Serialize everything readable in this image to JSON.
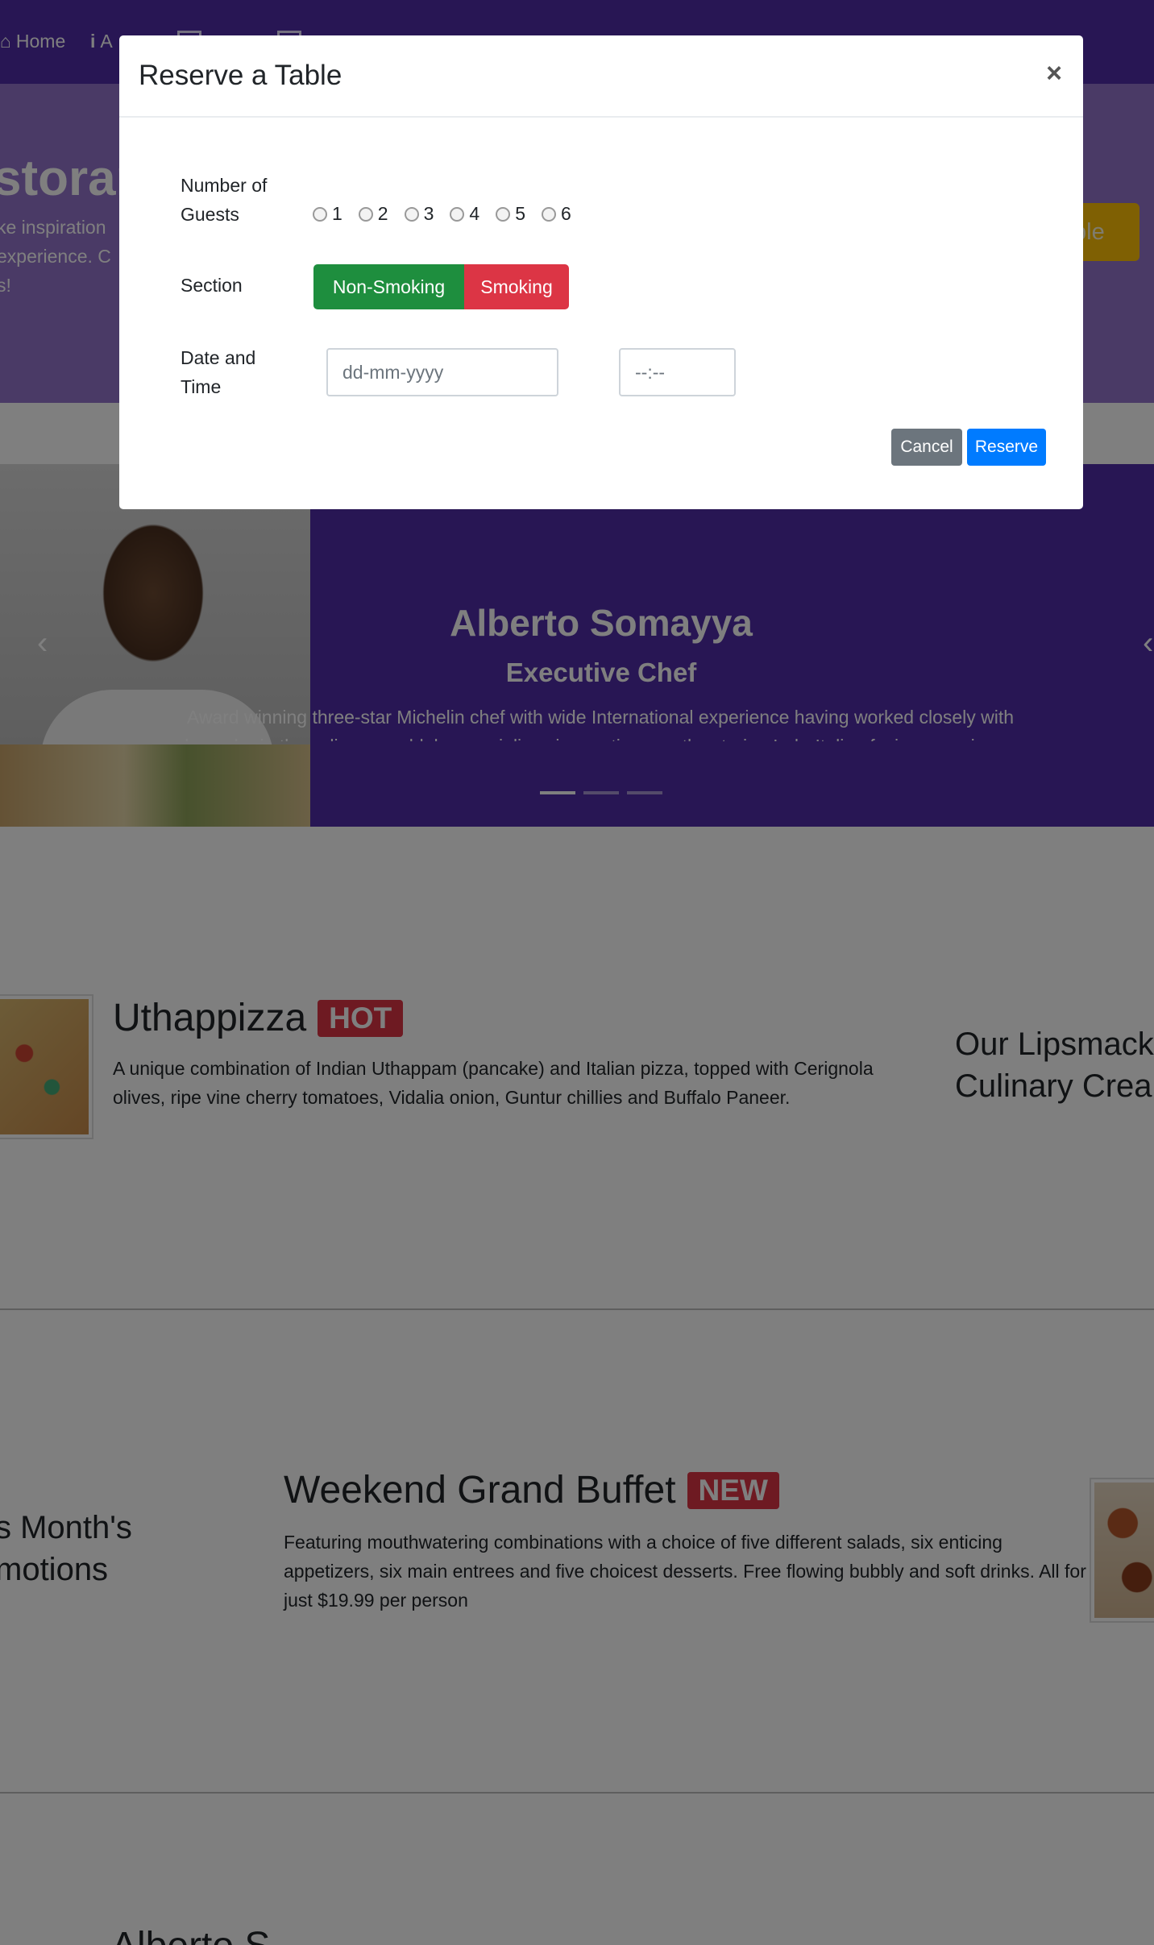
{
  "navbar": {
    "home_label": "Home",
    "about_label": "A",
    "home_icon": "home-icon",
    "about_icon": "info-icon"
  },
  "jumbotron": {
    "title": "storan",
    "text_lines": [
      "ke inspiration",
      " experience. C",
      "s!"
    ],
    "reserve_button": "ble"
  },
  "carousel": {
    "name": "Alberto Somayya",
    "role": "Executive Chef",
    "description": "Award winning three-star Michelin chef with wide International experience having worked closely with whos-who in the culinary world, he specializes in creating mouthwatering Indo-Italian fusion experiences. ripe vine cherry tomatoes, Vidalia onion, Guntur chillies and Buffalo Paneer."
  },
  "dishes": [
    {
      "name": "Uthappizza",
      "badge": "HOT",
      "description": "A unique combination of Indian Uthappam (pancake) and Italian pizza, topped with Cerignola olives, ripe vine cherry tomatoes, Vidalia onion, Guntur chillies and Buffalo Paneer."
    }
  ],
  "side_headings": {
    "dishes": [
      "Our Lipsmack",
      "Culinary Crea"
    ],
    "promotions": [
      "s Month's",
      "motions"
    ]
  },
  "promotion": {
    "name": "Weekend Grand Buffet",
    "badge": "NEW",
    "description": "Featuring mouthwatering combinations with a choice of five different salads, six enticing appetizers, six main entrees and five choicest desserts. Free flowing bubbly and soft drinks. All for just $19.99 per person"
  },
  "leader_partial": "Alberto S",
  "modal": {
    "title": "Reserve a Table",
    "close": "×",
    "guests_label": "Number of Guests",
    "guest_options": [
      "1",
      "2",
      "3",
      "4",
      "5",
      "6"
    ],
    "section_label": "Section",
    "section_options": [
      "Non-Smoking",
      "Smoking"
    ],
    "datetime_label": "Date and Time",
    "date_placeholder": "dd-mm-yyyy",
    "time_placeholder": "--:--",
    "cancel": "Cancel",
    "reserve": "Reserve"
  },
  "colors": {
    "primary": "#512da8",
    "jumbotron": "#9575cd",
    "warning": "#ffc107",
    "success": "#1e8e3e",
    "danger": "#dc3545",
    "info": "#007bff",
    "secondary": "#6c757d"
  }
}
